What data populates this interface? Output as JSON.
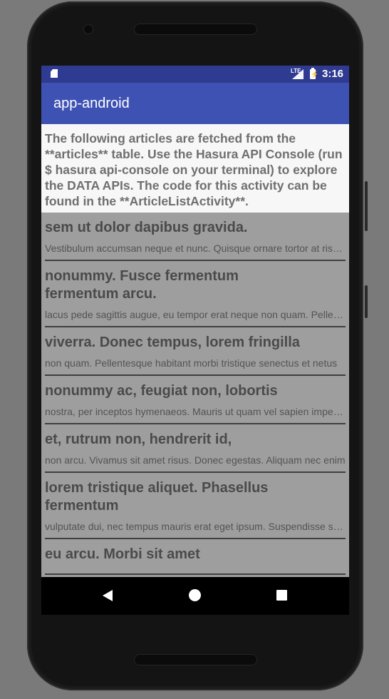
{
  "status_bar": {
    "network_label": "LTE",
    "time": "3:16"
  },
  "toolbar": {
    "title": "app-android"
  },
  "intro_text": "The following articles are fetched from the **articles** table. Use the Hasura API Console (run $ hasura api-console on your terminal) to explore the DATA APIs. The code for this activity can be found in the **ArticleListActivity**.",
  "articles": [
    {
      "title": "sem ut dolor dapibus gravida.",
      "snippet": "Vestibulum accumsan neque et nunc. Quisque ornare tortor at risus."
    },
    {
      "title": "nonummy. Fusce fermentum fermentum arcu.",
      "snippet": "lacus pede sagittis augue, eu tempor erat neque non quam. Pellentesque"
    },
    {
      "title": "viverra. Donec tempus, lorem fringilla",
      "snippet": "non quam. Pellentesque habitant morbi tristique senectus et netus"
    },
    {
      "title": "nonummy ac, feugiat non, lobortis",
      "snippet": "nostra, per inceptos hymenaeos. Mauris ut quam vel sapien imperdiet"
    },
    {
      "title": "et, rutrum non, hendrerit id,",
      "snippet": "non arcu. Vivamus sit amet risus. Donec egestas. Aliquam nec enim"
    },
    {
      "title": "lorem tristique aliquet. Phasellus fermentum",
      "snippet": "vulputate dui, nec tempus mauris erat eget ipsum. Suspendisse sagittis"
    },
    {
      "title": "eu arcu. Morbi sit amet",
      "snippet": ""
    }
  ],
  "colors": {
    "status_bar": "#2f3a91",
    "toolbar": "#3e52b3",
    "dim_overlay": "#9e9e9e"
  },
  "icons": {
    "sd_card": "sd-card-icon",
    "signal": "signal-icon",
    "battery": "battery-charging-icon",
    "back": "back-icon",
    "home": "home-icon",
    "recents": "recents-icon"
  }
}
